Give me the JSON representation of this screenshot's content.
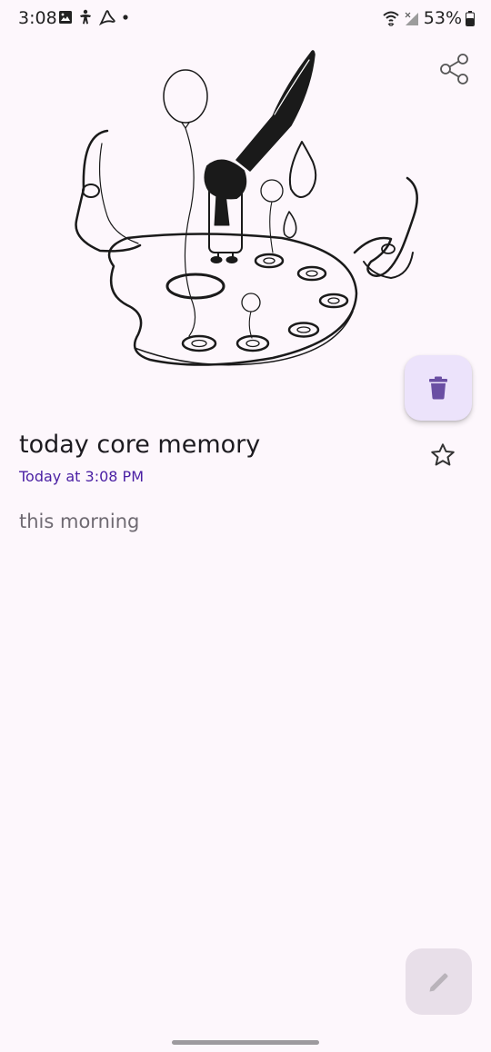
{
  "status_bar": {
    "time": "3:08",
    "battery": "53%",
    "icons_left": [
      "gallery-icon",
      "accessibility-icon",
      "pdf-icon",
      "notification-dot-icon"
    ],
    "icons_right": [
      "wifi-icon",
      "signal-icon",
      "battery-icon"
    ]
  },
  "header": {
    "share_icon": "share-icon"
  },
  "note": {
    "title": "today core memory",
    "timestamp": "Today at 3:08 PM",
    "body": "this morning",
    "illustration": "sketch-illustration-palette-balloons"
  },
  "actions": {
    "delete_icon": "trash-icon",
    "star_icon": "star-outline-icon",
    "edit_icon": "pencil-icon"
  },
  "colors": {
    "background": "#fdf7fc",
    "accent": "#4a1fa3",
    "delete_fab_bg": "#ece3fb",
    "delete_icon": "#6a4fa3"
  }
}
